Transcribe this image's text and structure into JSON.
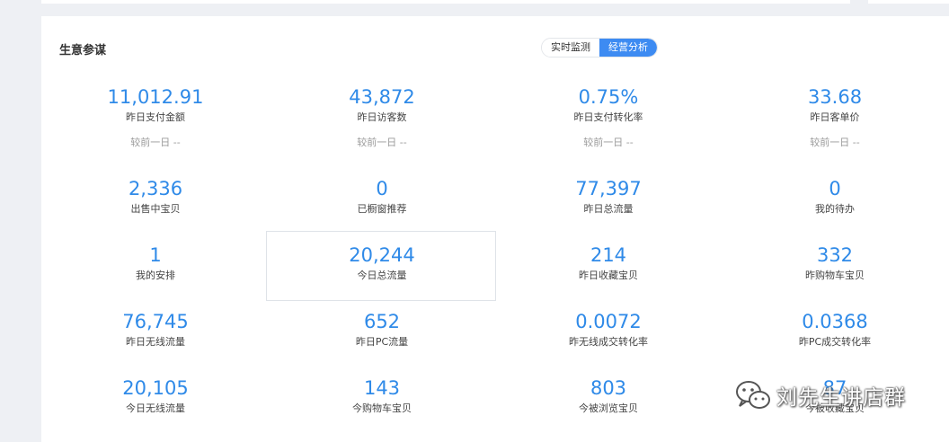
{
  "panel": {
    "title": "生意参谋",
    "tabs": [
      {
        "label": "实时监测",
        "active": false
      },
      {
        "label": "经营分析",
        "active": true
      }
    ]
  },
  "metrics": [
    {
      "value": "11,012.91",
      "label": "昨日支付金额",
      "compare": "较前一日 --"
    },
    {
      "value": "43,872",
      "label": "昨日访客数",
      "compare": "较前一日 --"
    },
    {
      "value": "0.75%",
      "label": "昨日支付转化率",
      "compare": "较前一日 --"
    },
    {
      "value": "33.68",
      "label": "昨日客单价",
      "compare": "较前一日 --"
    },
    {
      "value": "2,336",
      "label": "出售中宝贝"
    },
    {
      "value": "0",
      "label": "已橱窗推荐"
    },
    {
      "value": "77,397",
      "label": "昨日总流量"
    },
    {
      "value": "0",
      "label": "我的待办"
    },
    {
      "value": "1",
      "label": "我的安排"
    },
    {
      "value": "20,244",
      "label": "今日总流量"
    },
    {
      "value": "214",
      "label": "昨日收藏宝贝"
    },
    {
      "value": "332",
      "label": "昨购物车宝贝"
    },
    {
      "value": "76,745",
      "label": "昨日无线流量"
    },
    {
      "value": "652",
      "label": "昨日PC流量"
    },
    {
      "value": "0.0072",
      "label": "昨无线成交转化率"
    },
    {
      "value": "0.0368",
      "label": "昨PC成交转化率"
    },
    {
      "value": "20,105",
      "label": "今日无线流量"
    },
    {
      "value": "143",
      "label": "今购物车宝贝"
    },
    {
      "value": "803",
      "label": "今被浏览宝贝"
    },
    {
      "value": "87",
      "label": "今被收藏宝贝"
    }
  ],
  "watermark": {
    "text": "刘先生讲店群",
    "icon": "wechat-icon"
  },
  "colors": {
    "accent": "#3d8bf2",
    "value": "#2f8ae8"
  }
}
